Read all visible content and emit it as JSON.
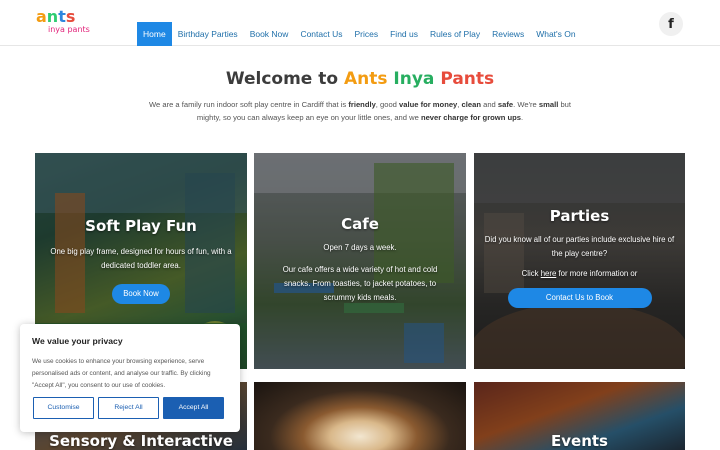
{
  "header": {
    "logo_line1": [
      "a",
      "n",
      "t",
      "s"
    ],
    "logo_line1_colors": [
      "#f39c12",
      "#2ecc71",
      "#2e86de",
      "#e74c3c"
    ],
    "logo_line2": "inya pants",
    "nav": [
      {
        "label": "Home",
        "active": true
      },
      {
        "label": "Birthday Parties"
      },
      {
        "label": "Book Now"
      },
      {
        "label": "Contact Us"
      },
      {
        "label": "Prices"
      },
      {
        "label": "Find us"
      },
      {
        "label": "Rules of Play"
      },
      {
        "label": "Reviews"
      },
      {
        "label": "What's On"
      }
    ],
    "facebook_icon": "facebook-icon",
    "facebook_glyph": "f"
  },
  "intro": {
    "welcome_prefix": "Welcome to",
    "brand_words": [
      "Ants",
      " Inya",
      " Pants"
    ],
    "p1": "We are a family run indoor soft play centre in Cardiff that is",
    "b1": "friendly",
    "p2": ", good",
    "b2": "value for money",
    "p3": ",",
    "b3": "clean",
    "p4": "and",
    "b4": "safe",
    "p5": ". We're",
    "b5": "small",
    "p6": "but mighty, so you can always keep an eye on your little ones, and we",
    "b6": "never charge for grown ups",
    "p7": "."
  },
  "cards": {
    "soft_play": {
      "title": "Soft Play Fun",
      "text": "One big play frame, designed for hours of fun, with a dedicated toddler area.",
      "button": "Book Now"
    },
    "cafe": {
      "title": "Cafe",
      "text1": "Open 7 days a week.",
      "text2": "Our cafe offers a wide variety of hot and cold snacks. From toasties, to jacket potatoes, to scrummy kids meals."
    },
    "parties": {
      "title": "Parties",
      "text1": "Did you know all of our parties include exclusive hire of the play centre?",
      "text2_a": "Click",
      "text2_link": "here",
      "text2_b": "for more information or",
      "button": "Contact Us to Book"
    },
    "sensory": {
      "title": "Sensory & Interactive"
    },
    "events": {
      "title": "Events"
    }
  },
  "cookie": {
    "title": "We value your privacy",
    "text": "We use cookies to enhance your browsing experience, serve personalised ads or content, and analyse our traffic. By clicking \"Accept All\", you consent to our use of cookies.",
    "customise": "Customise",
    "reject": "Reject All",
    "accept": "Accept All"
  },
  "colors": {
    "accent": "#1e88e5",
    "cookie_blue": "#1b5fb2"
  }
}
